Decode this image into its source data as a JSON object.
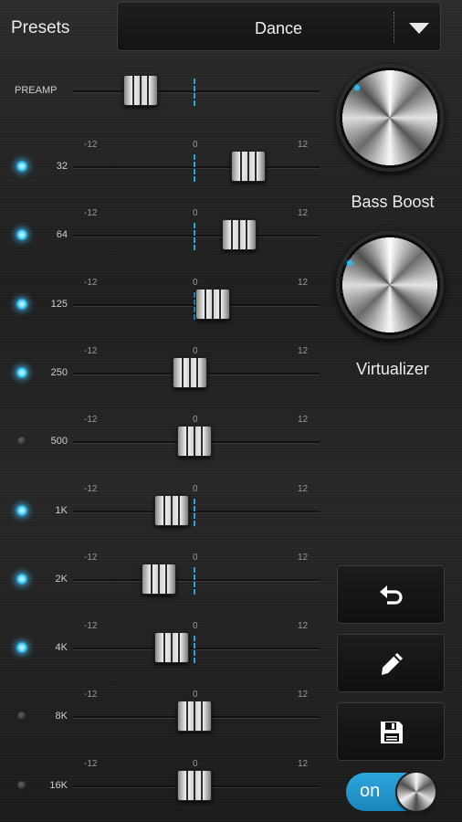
{
  "header": {
    "presets_label": "Presets",
    "preset_value": "Dance"
  },
  "preamp": {
    "label": "PREAMP",
    "level": -6
  },
  "scale": {
    "min": "-12",
    "mid": "0",
    "max": "12"
  },
  "bands": [
    {
      "label": "32",
      "enabled": true,
      "level": 6
    },
    {
      "label": "64",
      "enabled": true,
      "level": 5
    },
    {
      "label": "125",
      "enabled": true,
      "level": 2
    },
    {
      "label": "250",
      "enabled": true,
      "level": -0.5
    },
    {
      "label": "500",
      "enabled": false,
      "level": 0
    },
    {
      "label": "1K",
      "enabled": true,
      "level": -2.5
    },
    {
      "label": "2K",
      "enabled": true,
      "level": -4
    },
    {
      "label": "4K",
      "enabled": true,
      "level": -2.5
    },
    {
      "label": "8K",
      "enabled": false,
      "level": 0
    },
    {
      "label": "16K",
      "enabled": false,
      "level": 0
    }
  ],
  "effects": {
    "bass_boost": {
      "label": "Bass Boost",
      "level": 0
    },
    "virtualizer": {
      "label": "Virtualizer",
      "level": 0
    }
  },
  "actions": [
    {
      "name": "undo-button",
      "icon": "undo-icon"
    },
    {
      "name": "edit-button",
      "icon": "pencil-icon"
    },
    {
      "name": "save-button",
      "icon": "save-icon"
    }
  ],
  "power": {
    "label": "on",
    "state": true
  },
  "colors": {
    "accent": "#2fa3d8",
    "led_on": "#6fe0ff"
  }
}
